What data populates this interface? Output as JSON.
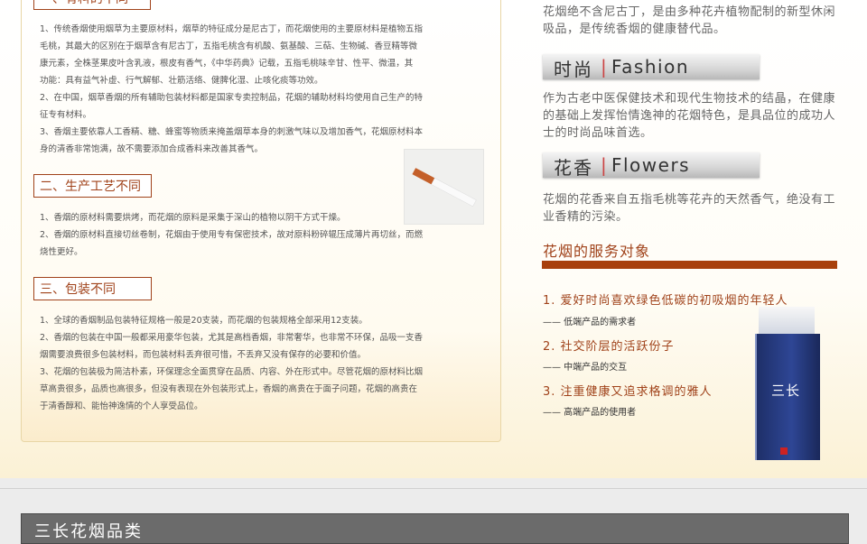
{
  "left": {
    "section1": {
      "title": "一、有料的不同",
      "paragraphs": [
        "1、传统香烟使用烟草为主要原材料，烟草的特征成分是尼古丁，而花烟使用的主要原材料是植物五指",
        "毛桃，其最大的区别在于烟草含有尼古丁，五指毛桃含有机酸、氨基酸、三萜、生物碱、香豆精等微",
        "康元素，全株茎果皮叶含乳液，根皮有香气，《中华药典》记载，五指毛桃味辛甘、性平、微温，其",
        "功能：具有益气补虚、行气解郁、壮筋活络、健脾化湿、止咳化痰等功效。",
        "2、在中国，烟草香烟的所有辅助包装材料都是国家专卖控制品，花烟的辅助材料均使用自己生产的特",
        "征专有材料。",
        "3、香烟主要依靠人工香精、糖、蜂蜜等物质来掩盖烟草本身的刺激气味以及增加香气，花烟原材料本",
        "身的清香非常饱满，故不需要添加合成香料来改善其香气。"
      ]
    },
    "section2": {
      "title": "二、生产工艺不同",
      "paragraphs": [
        "1、香烟的原材料需要烘烤，而花烟的原料是采集于深山的植物以阴干方式干燥。",
        "2、香烟的原材料直接切丝卷制，花烟由于使用专有保密技术，故对原料粉碎辊压成薄片再切丝，而燃",
        "烧性更好。"
      ]
    },
    "section3": {
      "title": "三、包装不同",
      "paragraphs": [
        "1、全球的香烟制品包装特征规格一般是20支装，而花烟的包装规格全部采用12支装。",
        "2、香烟的包装在中国一般都采用豪华包装，尤其是高档香烟，非常奢华，也非常不环保，品吸一支香",
        "烟需要浪费很多包装材料，而包装材料丢弃很可惜，不丢弃又没有保存的必要和价值。",
        "3、花烟的包装极为简洁朴素，环保理念全面贯穿在品质、内容、外在形式中。尽管花烟的原材料比烟",
        "草高贵很多，品质也高很多，但没有表现在外包装形式上，香烟的高贵在于面子问题，花烟的高贵在",
        "于清香醇和、能怡神逸情的个人享受品位。"
      ]
    }
  },
  "right": {
    "intro": "花烟绝不含尼古丁，是由多种花卉植物配制的新型休闲吸品，是传统香烟的健康替代品。",
    "fashion": {
      "zh": "时尚",
      "sep": "|",
      "en": "Fashion",
      "text": "作为古老中医保健技术和现代生物技术的结晶，在健康的基础上发挥怡情逸神的花烟特色，是具品位的成功人士的时尚品味首选。"
    },
    "flowers": {
      "zh": "花香",
      "sep": "|",
      "en": "Flowers",
      "text": "花烟的花香来自五指毛桃等花卉的天然香气，绝没有工业香精的污染。"
    },
    "service": {
      "title": "花烟的服务对象",
      "items": [
        {
          "label": "1. 爱好时尚喜欢绿色低碳的初吸烟的年轻人",
          "sub": "—— 低端产品的需求者"
        },
        {
          "label": "2. 社交阶层的活跃份子",
          "sub": "—— 中端产品的交互"
        },
        {
          "label": "3. 注重健康又追求格调的雅人",
          "sub": "—— 高端产品的使用者"
        }
      ]
    },
    "pack": {
      "logo": "三长"
    }
  },
  "category_bar": {
    "title": "三长花烟品类"
  },
  "colors": {
    "accent": "#a0421a",
    "rule": "#a8400c",
    "bar": "#6b6b6b"
  },
  "icons": {
    "cigarette": "cigarette-image",
    "pack": "cigarette-pack-image"
  }
}
